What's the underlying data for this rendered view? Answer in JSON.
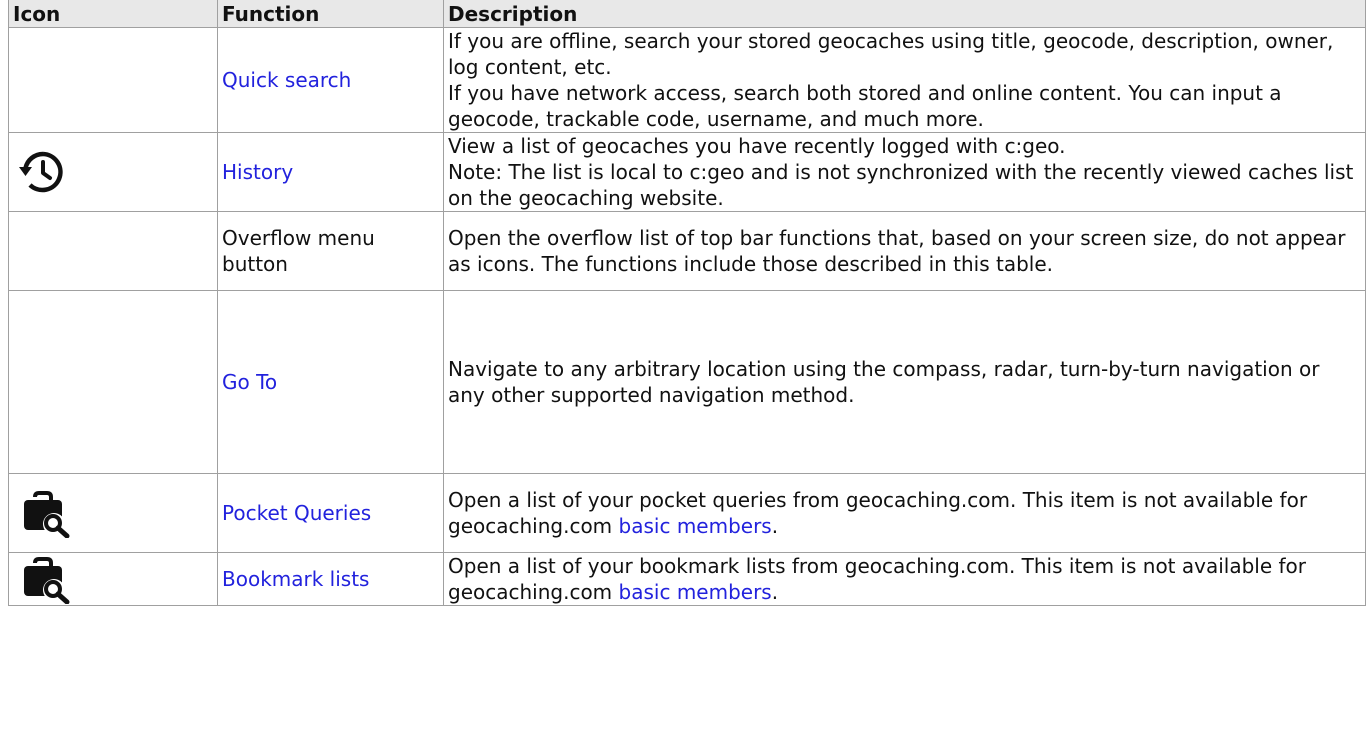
{
  "header": {
    "icon": "Icon",
    "function": "Function",
    "description": "Description"
  },
  "rows": [
    {
      "icon": "",
      "function": "Quick search",
      "function_is_link": true,
      "description_lines": [
        "If you are offline, search your stored geocaches using title, geocode, description, owner, log content, etc.",
        "If you have network access, search both stored and online content. You can input a geocode, trackable code, username, and much more."
      ]
    },
    {
      "icon": "history-icon",
      "function": "History",
      "function_is_link": true,
      "description_lines": [
        "View a list of geocaches you have recently logged with c:geo.",
        "Note: The list is local to c:geo and is not synchronized with the recently viewed caches list on the geocaching website."
      ]
    },
    {
      "icon": "",
      "function": "Overflow menu button",
      "function_is_link": false,
      "description_lines": [
        "Open the overflow list of top bar functions that, based on your screen size, do not appear as icons. The functions include those described in this table."
      ]
    },
    {
      "icon": "",
      "function": "Go To",
      "function_is_link": true,
      "description_lines": [
        "Navigate to any arbitrary location using the compass, radar, turn-by-turn navigation or any other supported navigation method."
      ]
    },
    {
      "icon": "briefcase-search-icon",
      "function": "Pocket Queries",
      "function_is_link": true,
      "description_prefix": "Open a list of your pocket queries from geocaching.com. This item is not available for geocaching.com ",
      "description_link": "basic members",
      "description_suffix": "."
    },
    {
      "icon": "briefcase-search-icon",
      "function": "Bookmark lists",
      "function_is_link": true,
      "description_prefix": "Open a list of your bookmark lists from geocaching.com. This item is not available for geocaching.com ",
      "description_link": "basic members",
      "description_suffix": "."
    }
  ],
  "colors": {
    "link": "#2222dd",
    "header_bg": "#e8e8e8",
    "border": "#a0a0a0"
  }
}
